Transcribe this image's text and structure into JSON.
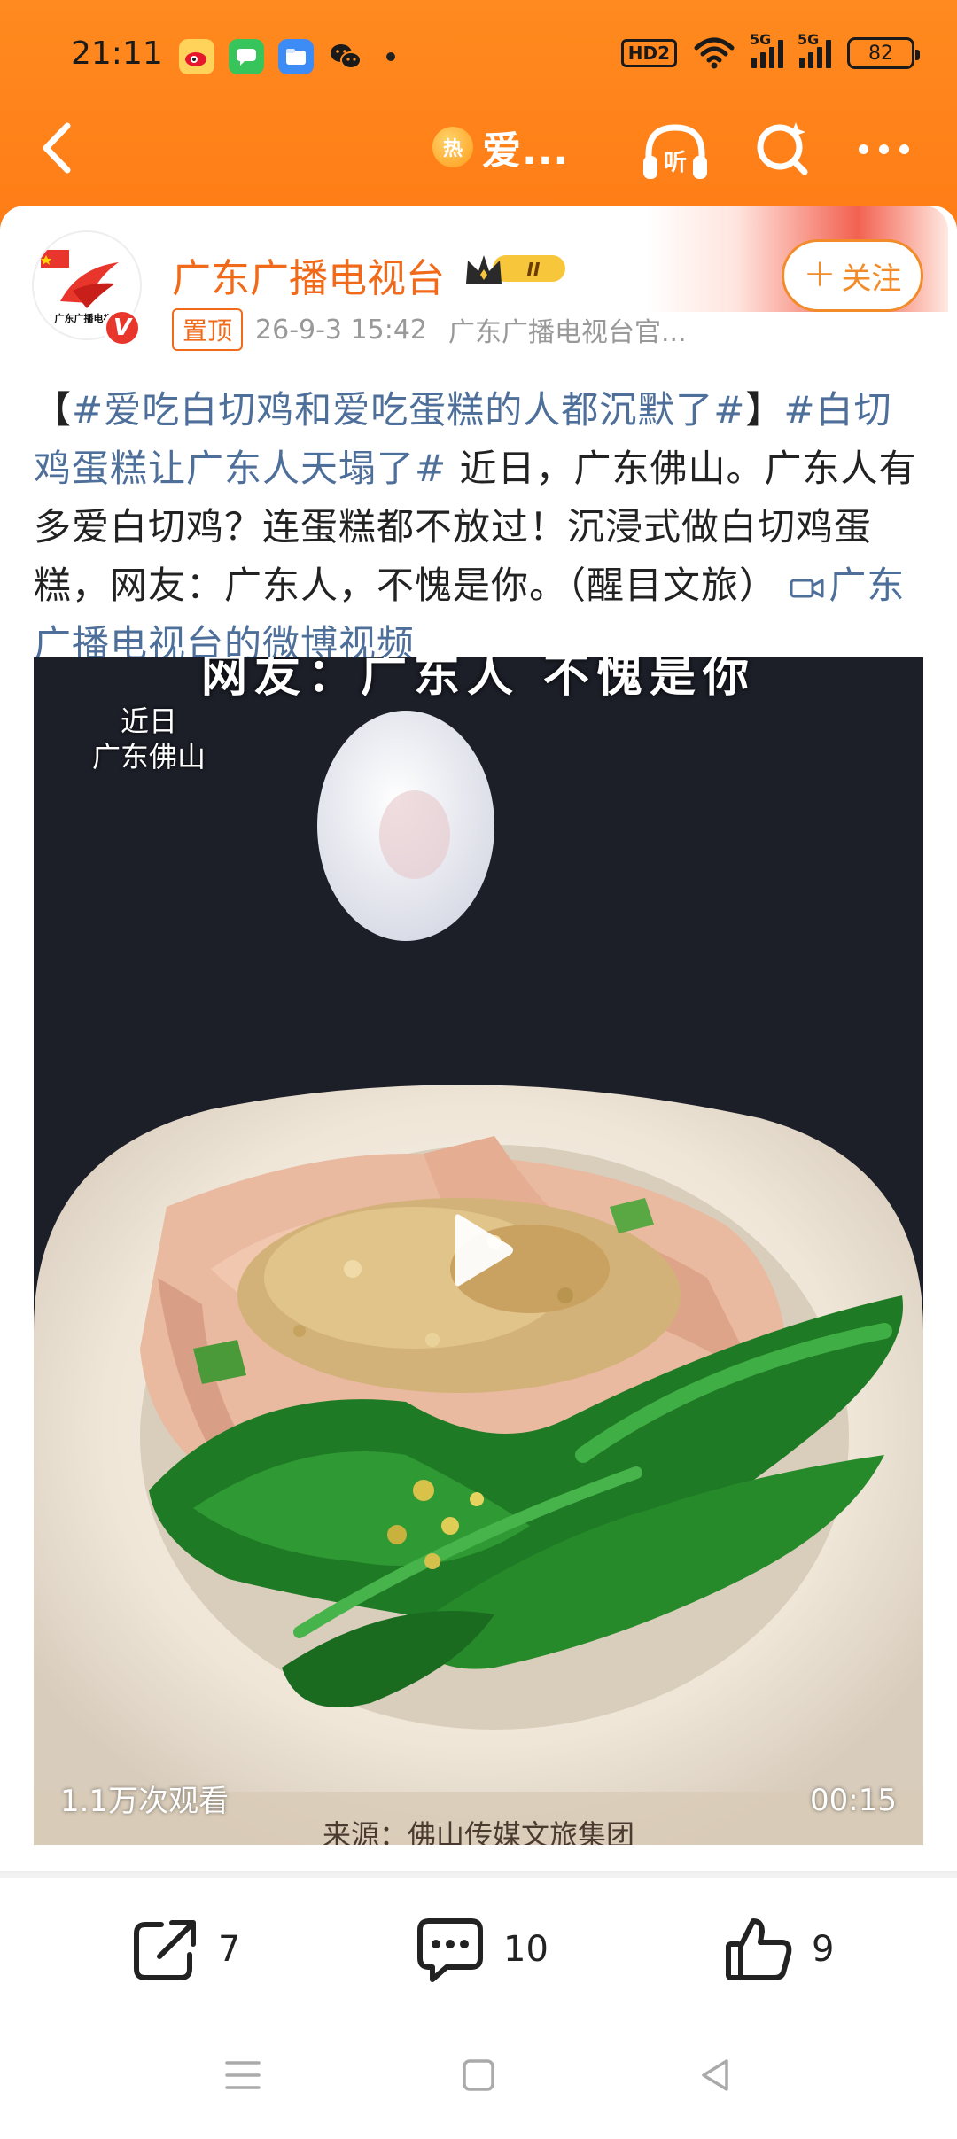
{
  "status_bar": {
    "time": "21:11",
    "hd_label": "HD2",
    "signal1_label": "5G",
    "signal2_label": "5G",
    "battery": "82"
  },
  "nav": {
    "hot_badge": "热",
    "title": "爱...",
    "listen_label": "听"
  },
  "author": {
    "name": "广东广播电视台",
    "vip_level": "II",
    "pinned_label": "置顶",
    "time": "26-9-3 15:42",
    "source": "广东广播电视台官...",
    "follow_label": "关注",
    "verified_mark": "V"
  },
  "post": {
    "bracket_open": "【",
    "tag1": "#爱吃白切鸡和爱吃蛋糕的人都沉默了#",
    "bracket_close": "】",
    "tag2": "#白切鸡蛋糕让广东人天塌了#",
    "body": " 近日，广东佛山。广东人有多爱白切鸡？连蛋糕都不放过！沉浸式做白切鸡蛋糕，网友：广东人，不愧是你。（醒目文旅）",
    "video_link": "广东广播电视台的微博视频"
  },
  "video": {
    "caption_line1": "近日",
    "caption_line2": "广东佛山",
    "cut_top_text": "网友：广东人 不愧是你",
    "views": "1.1万次观看",
    "duration": "00:15",
    "credit": "来源：佛山传媒文旅集团"
  },
  "actions": {
    "share_count": "7",
    "comment_count": "10",
    "like_count": "9"
  },
  "colors": {
    "header_orange": "#ff8a1f",
    "accent_orange": "#f06a1a",
    "link_blue": "#4d6f9a"
  }
}
